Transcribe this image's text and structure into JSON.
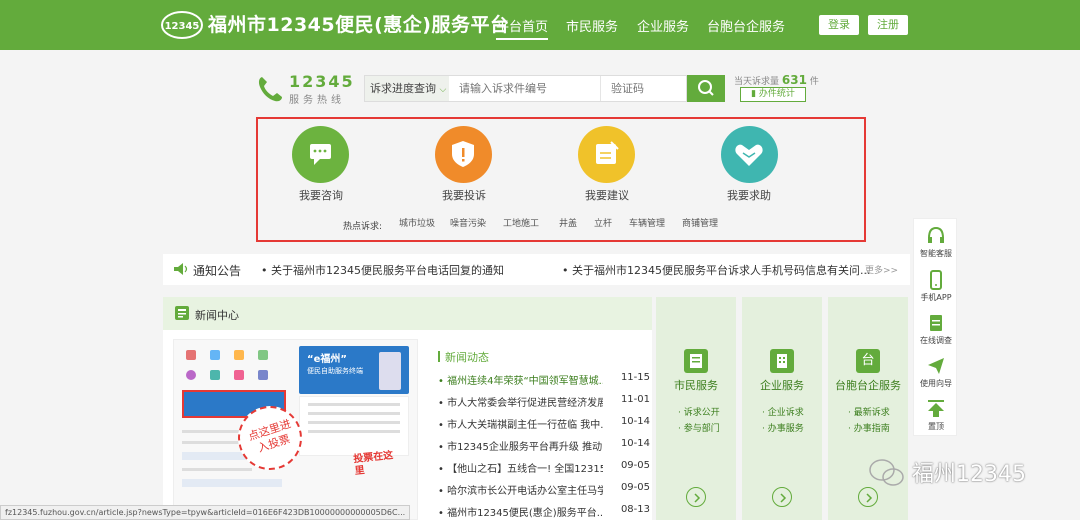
{
  "header": {
    "site_title": "福州市12345便民(惠企)服务平台",
    "nav": [
      "平台首页",
      "市民服务",
      "企业服务",
      "台胞台企服务"
    ],
    "login": "登录",
    "register": "注册",
    "brand_color": "#63ab3c"
  },
  "hotline": {
    "number": "12345",
    "subtitle": "服务热线"
  },
  "search": {
    "select_value": "诉求进度查询",
    "input_placeholder": "请输入诉求件编号",
    "captcha_placeholder": "验证码"
  },
  "counter": {
    "label": "当天诉求量",
    "value": "631",
    "unit": "件",
    "stats_button": "办件统计"
  },
  "services": [
    {
      "label": "我要咨询",
      "color": "#6cb33f",
      "icon": "chat-icon"
    },
    {
      "label": "我要投诉",
      "color": "#f08b2a",
      "icon": "shield-icon"
    },
    {
      "label": "我要建议",
      "color": "#f0c22a",
      "icon": "note-icon"
    },
    {
      "label": "我要求助",
      "color": "#3fb6b0",
      "icon": "handshake-icon"
    }
  ],
  "hot_topics": {
    "title": "热点诉求:",
    "tags": [
      "城市垃圾",
      "噪音污染",
      "工地施工",
      "井盖",
      "立杆",
      "车辆管理",
      "商铺管理"
    ]
  },
  "notice": {
    "title": "通知公告",
    "items": [
      "关于福州市12345便民服务平台电话回复的通知",
      "关于福州市12345便民服务平台诉求人手机号码信息有关问..."
    ],
    "more": "更多>>"
  },
  "news": {
    "section_title": "新闻中心",
    "sub_title": "新闻动态",
    "items": [
      {
        "title": "福州连续4年荣获“中国领军智慧城...",
        "date": "11-15",
        "highlight": true
      },
      {
        "title": "市人大常委会举行促进民营经济发展...",
        "date": "11-01",
        "highlight": false
      },
      {
        "title": "市人大关瑞祺副主任一行莅临 我中...",
        "date": "10-14",
        "highlight": false
      },
      {
        "title": "市12345企业服务平台再升级 推动...",
        "date": "10-14",
        "highlight": false
      },
      {
        "title": "【他山之石】五线合一! 全国12315...",
        "date": "09-05",
        "highlight": false
      },
      {
        "title": "哈尔滨市长公开电话办公室主任马学...",
        "date": "09-05",
        "highlight": false
      },
      {
        "title": "福州市12345便民(惠企)服务平台...",
        "date": "08-13",
        "highlight": false
      }
    ],
    "image_text": {
      "banner": "“e福州”",
      "banner_sub": "便民自助服务终端",
      "vote": "点这里进入投票",
      "vote2": "投票在这里"
    }
  },
  "columns": [
    {
      "title": "市民服务",
      "links": [
        "诉求公开",
        "参与部门"
      ]
    },
    {
      "title": "企业服务",
      "links": [
        "企业诉求",
        "办事服务"
      ]
    },
    {
      "title": "台胞台企服务",
      "links": [
        "最新诉求",
        "办事指南"
      ]
    }
  ],
  "side_tools": [
    "智能客服",
    "手机APP",
    "在线调查",
    "使用向导",
    "置顶"
  ],
  "watermark": "福州12345",
  "status_url": "fz12345.fuzhou.gov.cn/article.jsp?newsType=tpyw&articleId=016E6F423DB10000000000005D6C..."
}
